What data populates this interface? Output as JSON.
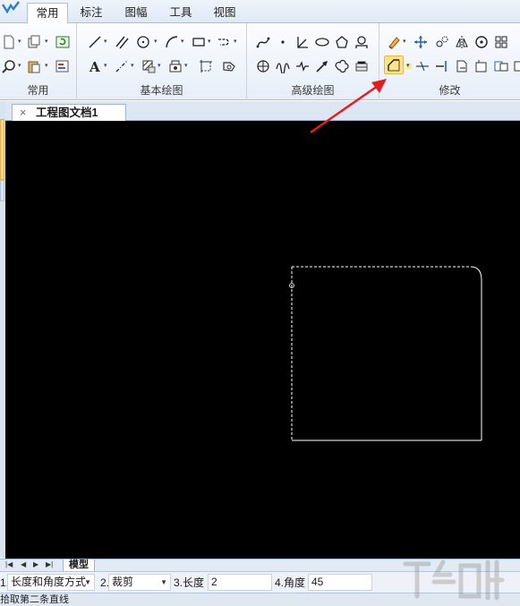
{
  "ribbon_tabs": [
    "常用",
    "标注",
    "图幅",
    "工具",
    "视图"
  ],
  "groups": {
    "common": "常用",
    "basic": "基本绘图",
    "advanced": "高级绘图",
    "modify": "修改"
  },
  "document": {
    "tab_title": "工程图文档1",
    "close_glyph": "×"
  },
  "bottom": {
    "nav": [
      "|◀",
      "◀",
      "▶",
      "▶|"
    ],
    "model_tab": "模型"
  },
  "command_bar": {
    "item1_index": "1.",
    "item1_value": "长度和角度方式",
    "item2_index": "2.",
    "item2_value": "裁剪",
    "item3_label": "3.长度",
    "item3_value": "2",
    "item4_label": "4.角度",
    "item4_value": "45"
  },
  "status": "拾取第二条直线",
  "colors": {
    "canvas": "#000000",
    "arrow": "#e02020",
    "highlight": "#ffe48a"
  }
}
